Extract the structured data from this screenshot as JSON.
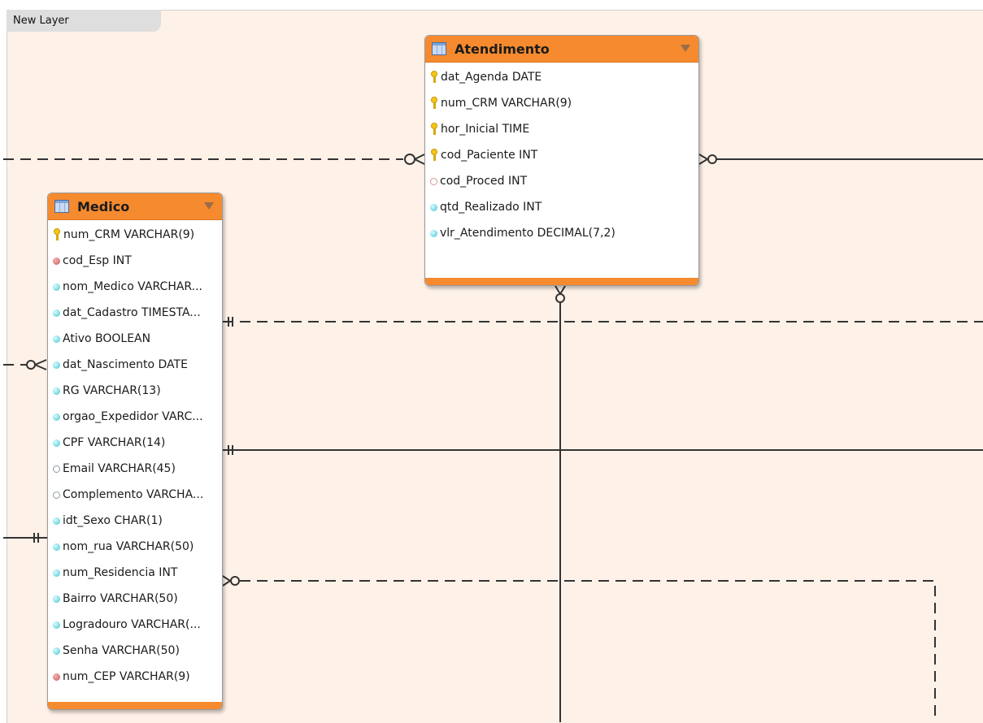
{
  "layer": {
    "name": "New Layer"
  },
  "tables": {
    "atendimento": {
      "title": "Atendimento",
      "columns": [
        {
          "label": "dat_Agenda DATE",
          "icon": "primary-key-icon"
        },
        {
          "label": "num_CRM VARCHAR(9)",
          "icon": "primary-key-icon"
        },
        {
          "label": "hor_Inicial TIME",
          "icon": "primary-key-icon"
        },
        {
          "label": "cod_Paciente INT",
          "icon": "primary-key-icon"
        },
        {
          "label": "cod_Proced INT",
          "icon": "nullable-foreign-key-icon"
        },
        {
          "label": "qtd_Realizado INT",
          "icon": "column-icon"
        },
        {
          "label": "vlr_Atendimento DECIMAL(7,2)",
          "icon": "column-icon"
        }
      ]
    },
    "medico": {
      "title": "Medico",
      "columns": [
        {
          "label": "num_CRM VARCHAR(9)",
          "icon": "primary-key-icon"
        },
        {
          "label": "cod_Esp INT",
          "icon": "foreign-key-icon"
        },
        {
          "label": "nom_Medico VARCHAR...",
          "icon": "column-icon"
        },
        {
          "label": "dat_Cadastro TIMESTA...",
          "icon": "column-icon"
        },
        {
          "label": "Ativo BOOLEAN",
          "icon": "column-icon"
        },
        {
          "label": "dat_Nascimento DATE",
          "icon": "column-icon"
        },
        {
          "label": "RG VARCHAR(13)",
          "icon": "column-icon"
        },
        {
          "label": "orgao_Expedidor VARC...",
          "icon": "column-icon"
        },
        {
          "label": "CPF VARCHAR(14)",
          "icon": "column-icon"
        },
        {
          "label": "Email VARCHAR(45)",
          "icon": "nullable-column-icon"
        },
        {
          "label": "Complemento VARCHA...",
          "icon": "nullable-column-icon"
        },
        {
          "label": "idt_Sexo CHAR(1)",
          "icon": "column-icon"
        },
        {
          "label": "nom_rua VARCHAR(50)",
          "icon": "column-icon"
        },
        {
          "label": "num_Residencia INT",
          "icon": "column-icon"
        },
        {
          "label": "Bairro VARCHAR(50)",
          "icon": "column-icon"
        },
        {
          "label": "Logradouro VARCHAR(...",
          "icon": "column-icon"
        },
        {
          "label": "Senha VARCHAR(50)",
          "icon": "column-icon"
        },
        {
          "label": "num_CEP VARCHAR(9)",
          "icon": "foreign-key-icon"
        }
      ]
    }
  },
  "colors": {
    "canvas": "#fdf1e8",
    "header": "#f58a2f",
    "line": "#333333"
  }
}
